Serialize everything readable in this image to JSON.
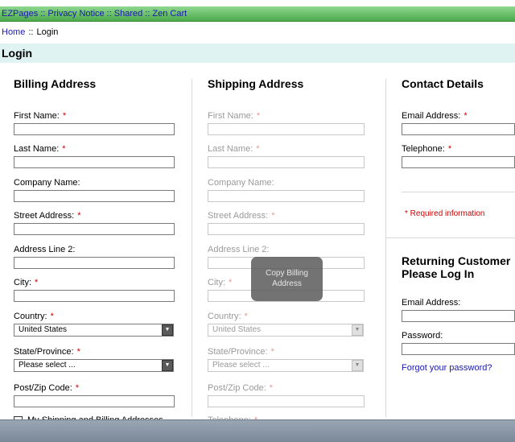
{
  "topnav": {
    "items": [
      "EZPages",
      "Privacy Notice",
      "Shared",
      "Zen Cart"
    ],
    "separator": "::"
  },
  "breadcrumb": {
    "home": "Home",
    "separator": "::",
    "current": "Login"
  },
  "page_title": "Login",
  "billing": {
    "heading": "Billing Address",
    "first_name": "First Name:",
    "last_name": "Last Name:",
    "company": "Company Name:",
    "street": "Street Address:",
    "line2": "Address Line 2:",
    "city": "City:",
    "country": "Country:",
    "country_value": "United States",
    "state": "State/Province:",
    "state_value": "Please select ...",
    "zip": "Post/Zip Code:",
    "same_address_label": "My Shipping and Billing Addresses"
  },
  "shipping": {
    "heading": "Shipping Address",
    "first_name": "First Name:",
    "last_name": "Last Name:",
    "company": "Company Name:",
    "street": "Street Address:",
    "line2": "Address Line 2:",
    "city": "City:",
    "country": "Country:",
    "country_value": "United States",
    "state": "State/Province:",
    "state_value": "Please select ...",
    "zip": "Post/Zip Code:",
    "telephone": "Telephone:"
  },
  "overlay": {
    "line1": "Copy Billing",
    "line2": "Address"
  },
  "contact": {
    "heading": "Contact Details",
    "email": "Email Address:",
    "telephone": "Telephone:",
    "required_info": "* Required information"
  },
  "returning": {
    "heading_line1": "Returning Customer",
    "heading_line2": "Please Log In",
    "email": "Email Address:",
    "password": "Password:",
    "forgot": "Forgot your password?"
  },
  "required_marker": "*",
  "colors": {
    "accent_green": "#4caa4c",
    "title_bg": "#dff3f3",
    "required_red": "#cc0000",
    "link_blue": "#1a1aaa"
  }
}
